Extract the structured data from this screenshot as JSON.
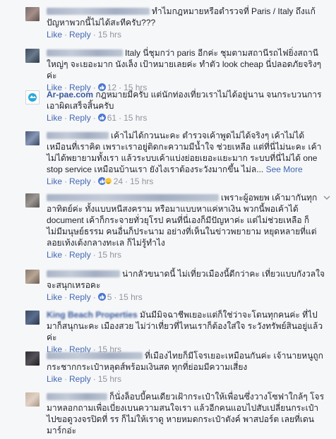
{
  "actions": {
    "like": "Like",
    "reply": "Reply",
    "see_more": "See More"
  },
  "comments": [
    {
      "name": "",
      "text": "ทำไมกฎหมายหรือตำรวจที่ Paris / Italy ถึงแก้ปัญหาพวกนี้ไม่ได้สะทีครับ???",
      "likes": "",
      "time": "15 hrs"
    },
    {
      "name": "",
      "text": "Italy นี่ชุมกว่า paris อีกค่ะ ชุมตามสถานีรถไฟยิ่งสถานีใหญ่ๆ จะเยอะมาก นังเล็ง เป้าหมายเลยค่ะ ทำตัว look cheap นี่ปลอดภัยจริงๆค่ะ",
      "likes": "12",
      "time": "15 hrs"
    },
    {
      "name": "Ar-pae.com",
      "text": "กฎหมายมีครับ แต่นักท่องเที่ยวเราไม่ได้อยู่นาน จนกระบวนการเอาผิดเสร็จสิ้นครับ",
      "likes": "61",
      "time": "15 hrs"
    },
    {
      "name": "",
      "text": "เค้าไม่ได้กวนนะคะ ตำรวจเค้าพูดไม่ได้จริงๆ เค้าไม่ได้เหมือนที่เราคิด เพราะเราอยู่ติดกะความมีน้ำใจ ช่วยเหลือ แต่ที่นี่ไม่นะคะ เค้าไม่ได้พยายามทั้งเรา แล้วระบบเค้าแบ่งย่อยเยอะแยะมาก ระบบที่นี่ไม่ได้ one stop service เหมือนบ้านเรา ยังไงเราต้องระวังมากขึ้น ไม่ล...",
      "likes": "24",
      "time": "15 hrs"
    },
    {
      "name": "",
      "text": "เพราะผู้อพยพ เค้ามากันทุกอาทิตย์ค่ะ ทั้งแบบหนีสงคราม หรือมาแบบหาแค่หาเงิน พวกนี้พอเค้าได้ document เค้าก็กระจายทั่วยุโรป คนที่นี่เองก็มีปัญหาค่ะ แต่ไม่ช่วยเหลือ ก็ไม่มีมนุษย์ธรรม คนอื่นก็ประนาม อย่างที่เห็นในข่าวพยายาม หยุดหลายที่แต่ลอยเท้งเต้งกลางทะเล ก็ไม่รู้ทำไง",
      "likes": "",
      "time": "15 hrs"
    },
    {
      "name": "",
      "text": "น่ากลัวขนาดนี้ ไม่เที่ยวเมืองนี้ดีกว่าคะ เที่ยวแบบกังวลใจจะสนุกเหรอคะ",
      "likes": "5",
      "time": "15 hrs"
    },
    {
      "name": "King Beach Properties",
      "text": "มันมีมิจฉาชีพเยอะแต่ก็ใช่ว่าจะโดนทุกคนค่ะ ที่ไปมาก็สนุกนะคะ เมืองสวย ไม่ว่าเที่ยวที่ไหนเราก็ต้องใส่ใจ ระวังทรัพย์สินอยู่แล้วค่ะ",
      "likes": "",
      "time": "15 hrs"
    },
    {
      "name": "",
      "text": "ที่เมืองไทยก็มีโจรเยอะเหมือนกันค่ะ เจ้านายหนูถูกกระชากกระเป๋าหลุดส์พร้อมเงินสด ทุกที่ย่อมมีความเสี่ยง",
      "likes": "",
      "time": "15 hrs"
    },
    {
      "name": "",
      "text": "ก็นั่งล็อบบี้คนเดียวเฝ้ากระเป๋าให้เพื่อนซึ่งวางโซฟาใกล้ๆ โจรมาหลอกถามเพื่อเบี่ยงเบนความสนใจเรา แล้วอีกคนแอบไปสับเปลี่ยนกระเป๋า ไปขอดูวงจรปิดที่ รร ก็ไม่ให้เราดู หายหมดกระเป๋าตังค์ พาสปอร์ต เลยที่เดนมาร์กอ่ะ",
      "likes": "",
      "time": ""
    }
  ],
  "colors": {
    "link": "#4267b2",
    "name": "#365899",
    "meta": "#90949c",
    "text": "#1d2129",
    "bg": "#f6f7f9"
  }
}
